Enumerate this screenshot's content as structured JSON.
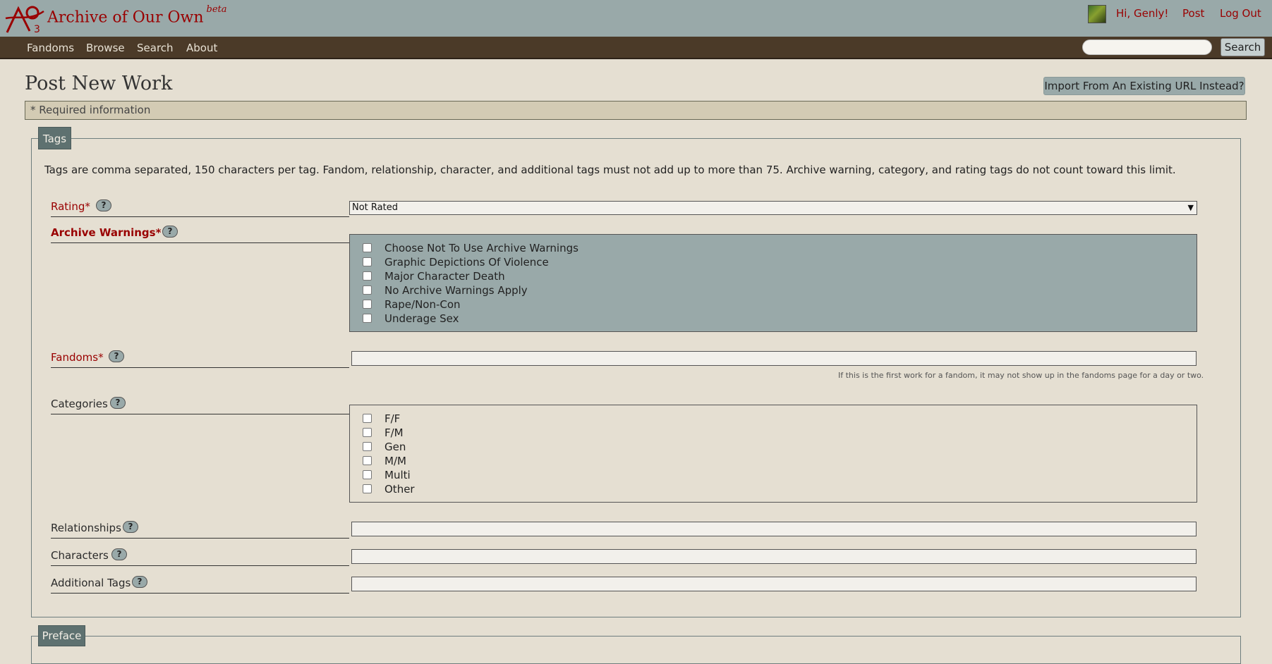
{
  "header": {
    "site_title": "Archive of Our Own",
    "site_title_beta": "beta",
    "greeting": "Hi, Genly!",
    "post": "Post",
    "logout": "Log Out"
  },
  "nav": {
    "items": [
      "Fandoms",
      "Browse",
      "Search",
      "About"
    ],
    "search_button": "Search"
  },
  "page": {
    "title": "Post New Work",
    "import_button": "Import From An Existing URL Instead?",
    "required_note": "* Required information"
  },
  "tags": {
    "legend": "Tags",
    "intro": "Tags are comma separated, 150 characters per tag. Fandom, relationship, character, and additional tags must not add up to more than 75. Archive warning, category, and rating tags do not count toward this limit.",
    "help_glyph": "?",
    "rating": {
      "label": "Rating*",
      "selected": "Not Rated"
    },
    "warnings": {
      "label": "Archive Warnings*",
      "options": [
        "Choose Not To Use Archive Warnings",
        "Graphic Depictions Of Violence",
        "Major Character Death",
        "No Archive Warnings Apply",
        "Rape/Non-Con",
        "Underage Sex"
      ]
    },
    "fandoms": {
      "label": "Fandoms*",
      "hint": "If this is the first work for a fandom, it may not show up in the fandoms page for a day or two."
    },
    "categories": {
      "label": "Categories",
      "options": [
        "F/F",
        "F/M",
        "Gen",
        "M/M",
        "Multi",
        "Other"
      ]
    },
    "relationships": {
      "label": "Relationships"
    },
    "characters": {
      "label": "Characters"
    },
    "additional": {
      "label": "Additional Tags"
    }
  },
  "preface": {
    "legend": "Preface"
  },
  "colors": {
    "header_bg": "#99a9a9",
    "nav_bg": "#4b3a28",
    "brand_red": "#990000",
    "page_bg": "#e5dfd2",
    "warnings_bg": "#99a9a9",
    "legend_bg": "#5e7170"
  }
}
